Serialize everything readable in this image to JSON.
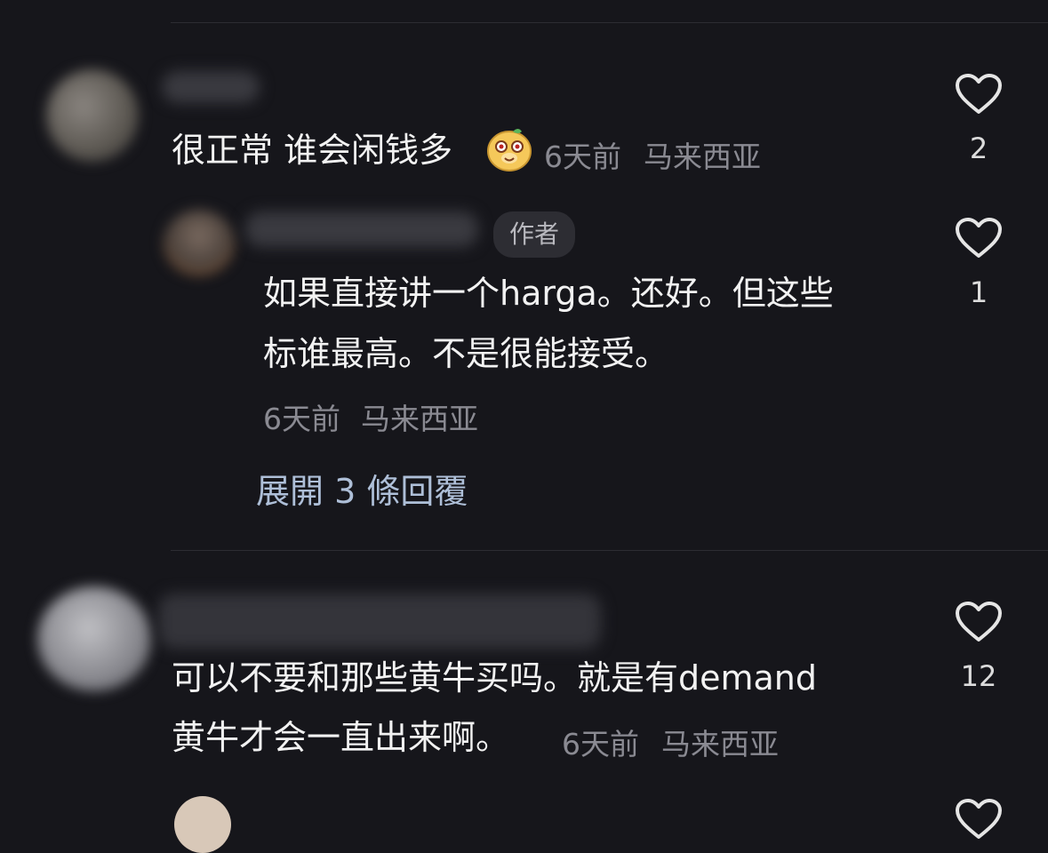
{
  "comments": [
    {
      "text": "很正常 谁会闲钱多",
      "time": "6天前",
      "location": "马来西亚",
      "emoji_icon": "smiling-animal-face-icon",
      "likes": "2",
      "reply": {
        "author_badge": "作者",
        "text_line1": "如果直接讲一个harga。还好。但这些",
        "text_line2": "标谁最高。不是很能接受。",
        "time": "6天前",
        "location": "马来西亚",
        "likes": "1"
      },
      "expand_replies": "展開 3 條回覆"
    },
    {
      "text_line1": "可以不要和那些黄牛买吗。就是有demand",
      "text_line2": "黄牛才会一直出来啊。",
      "time": "6天前",
      "location": "马来西亚",
      "likes": "12"
    }
  ],
  "colors": {
    "background": "#16161b",
    "text": "#f2f2f2",
    "meta": "#8a8a92",
    "link": "#aebfd8",
    "divider": "#2c2c33"
  }
}
